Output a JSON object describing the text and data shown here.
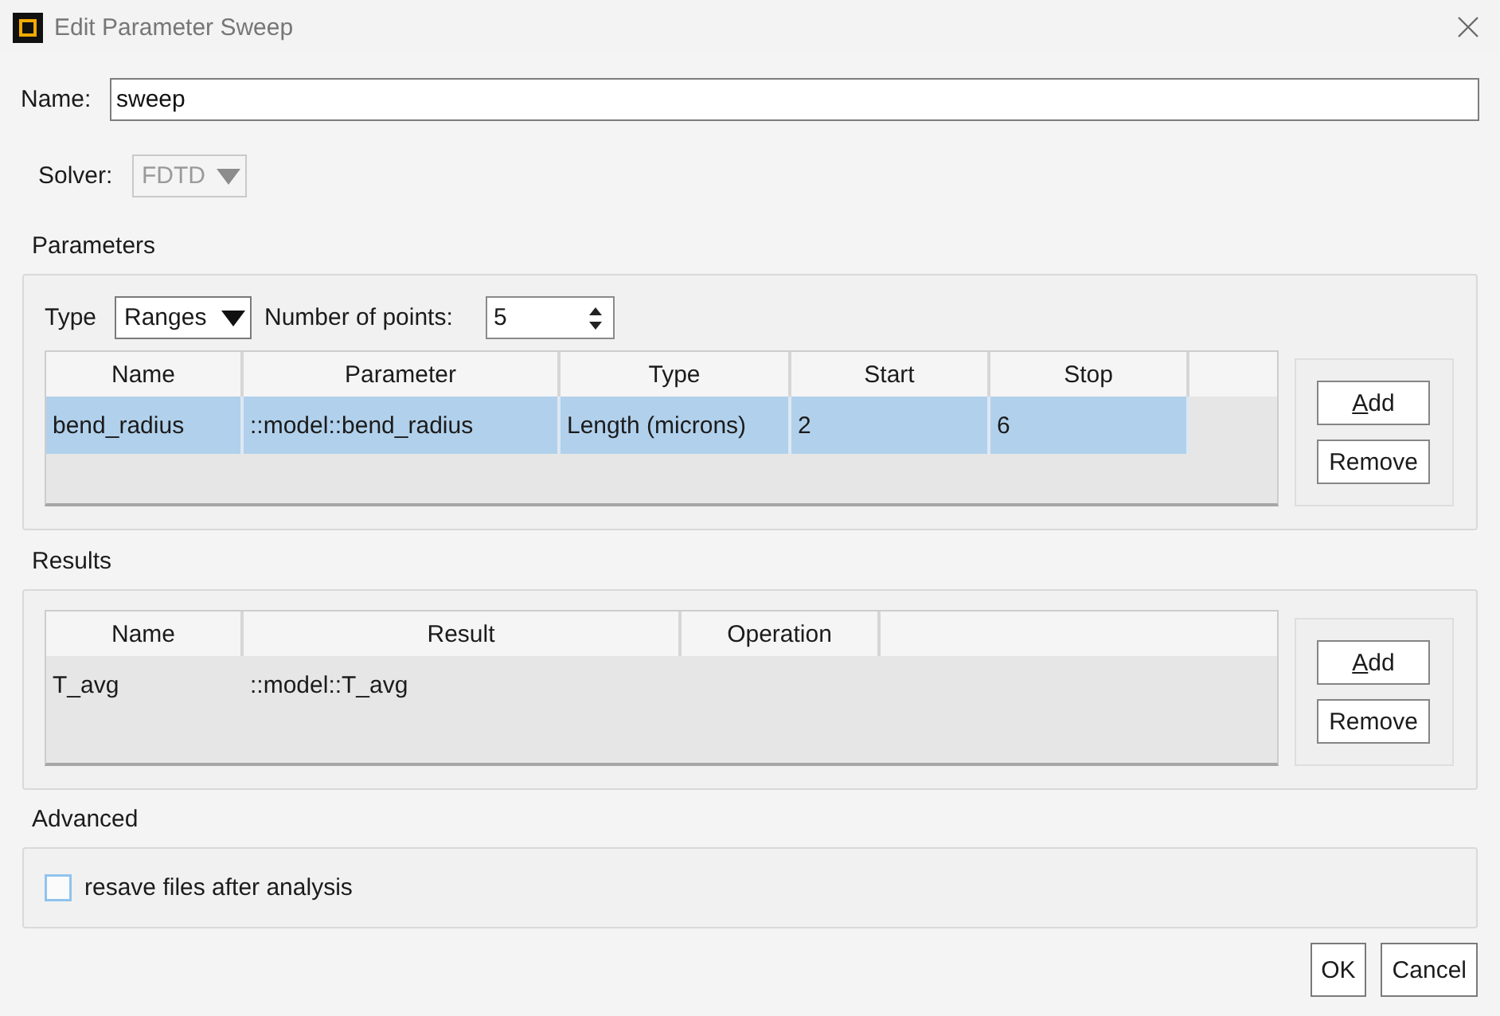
{
  "window": {
    "title": "Edit Parameter Sweep"
  },
  "name_field": {
    "label": "Name:",
    "value": "sweep"
  },
  "solver": {
    "label": "Solver:",
    "value": "FDTD",
    "disabled": true
  },
  "parameters": {
    "title": "Parameters",
    "type": {
      "label": "Type",
      "value": "Ranges"
    },
    "points": {
      "label": "Number of points:",
      "value": "5"
    },
    "table": {
      "columns": [
        "Name",
        "Parameter",
        "Type",
        "Start",
        "Stop"
      ],
      "rows": [
        {
          "cells": [
            "bend_radius",
            "::model::bend_radius",
            "Length (microns)",
            "2",
            "6"
          ],
          "selected": true
        }
      ]
    },
    "buttons": [
      {
        "label": "Add",
        "mnemonic": true
      },
      {
        "label": "Remove",
        "mnemonic": false
      }
    ]
  },
  "results": {
    "title": "Results",
    "table": {
      "columns": [
        "Name",
        "Result",
        "Operation"
      ],
      "rows": [
        {
          "cells": [
            "T_avg",
            "::model::T_avg"
          ],
          "selected": false
        }
      ]
    },
    "buttons": [
      {
        "label": "Add",
        "mnemonic": true
      },
      {
        "label": "Remove",
        "mnemonic": false
      }
    ]
  },
  "advanced": {
    "title": "Advanced",
    "options": [
      {
        "label": "resave files after analysis",
        "checked": false
      }
    ]
  },
  "dialog_buttons": [
    {
      "label": "OK"
    },
    {
      "label": "Cancel"
    }
  ]
}
